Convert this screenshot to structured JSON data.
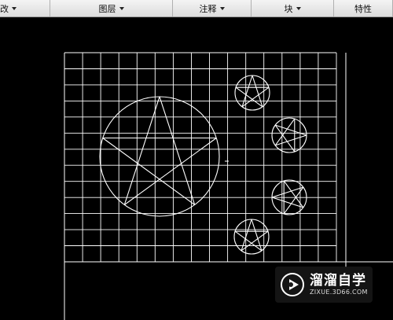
{
  "ribbon": {
    "modify_label": "改",
    "layers_label": "图层",
    "annotation_label": "注释",
    "block_label": "块",
    "properties_label": "特性"
  },
  "canvas": {
    "line_color": "#ffffff",
    "background_color": "#000000"
  },
  "watermark": {
    "title": "溜溜自学",
    "url": "ZIXUE.3D66.COM"
  }
}
